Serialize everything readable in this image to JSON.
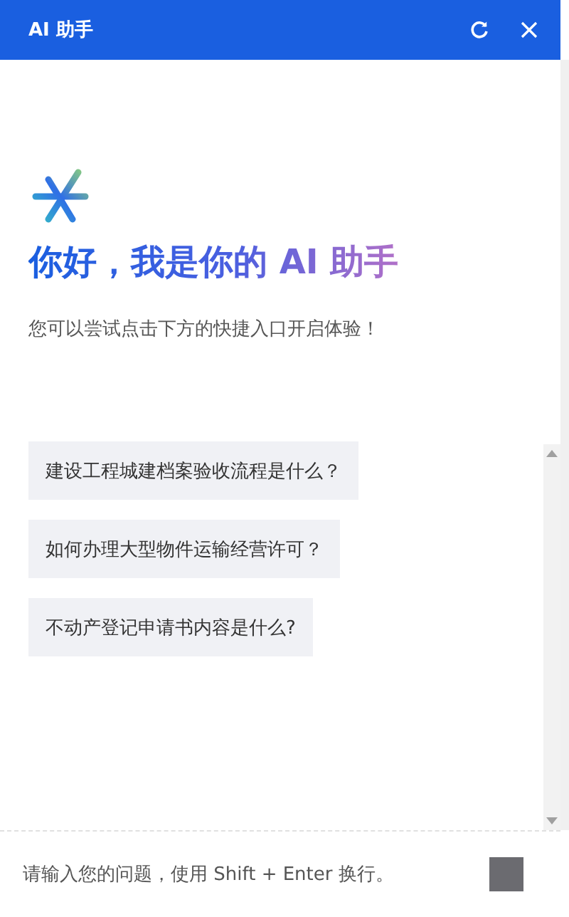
{
  "header": {
    "title": "AI 助手"
  },
  "welcome": {
    "heading": "你好，我是你的 AI 助手",
    "subtitle": "您可以尝试点击下方的快捷入口开启体验！"
  },
  "suggestions": [
    {
      "text": "建设工程城建档案验收流程是什么？"
    },
    {
      "text": "如何办理大型物件运输经营许可？"
    },
    {
      "text": "不动产登记申请书内容是什么?"
    }
  ],
  "input": {
    "placeholder": "请输入您的问题，使用 Shift + Enter 换行。"
  }
}
